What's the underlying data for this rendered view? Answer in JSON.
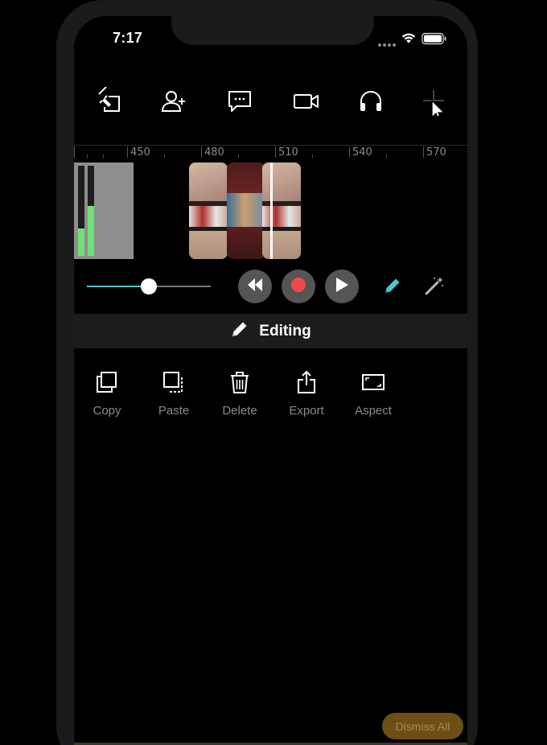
{
  "status_bar": {
    "time": "7:17",
    "icons": [
      "signal-dots-icon",
      "wifi-icon",
      "battery-icon"
    ]
  },
  "toolbar": {
    "items": [
      {
        "name": "back-edit-icon"
      },
      {
        "name": "add-user-icon"
      },
      {
        "name": "chat-icon"
      },
      {
        "name": "video-camera-icon"
      },
      {
        "name": "headphones-icon"
      },
      {
        "name": "add-icon"
      }
    ]
  },
  "timeline": {
    "ruler_labels": [
      "450",
      "480",
      "510",
      "540",
      "570"
    ],
    "level_meter": [
      0.3,
      0.55
    ],
    "colors": {
      "meter": "#6ee07a",
      "track": "#8e8e8e",
      "accent": "#55c3c9",
      "record": "#f04848"
    }
  },
  "transport": {
    "volume": 0.5,
    "buttons": [
      "rewind-icon",
      "record-icon",
      "play-icon"
    ],
    "tools": [
      "pencil-icon",
      "magic-wand-icon"
    ]
  },
  "editing": {
    "title": "Editing",
    "actions": [
      {
        "label": "Copy",
        "icon": "copy-icon"
      },
      {
        "label": "Paste",
        "icon": "paste-icon"
      },
      {
        "label": "Delete",
        "icon": "trash-icon"
      },
      {
        "label": "Export",
        "icon": "export-icon"
      },
      {
        "label": "Aspect",
        "icon": "aspect-ratio-icon"
      }
    ]
  },
  "dismiss_label": "Dismiss All"
}
